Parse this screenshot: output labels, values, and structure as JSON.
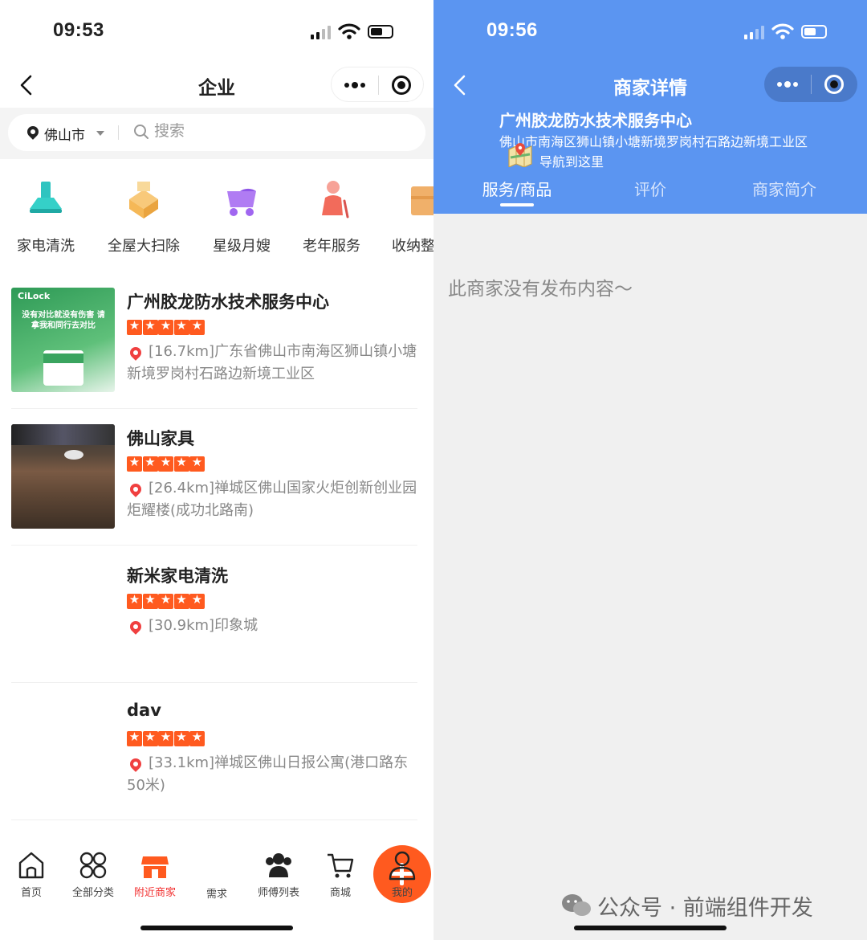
{
  "left": {
    "status": {
      "time": "09:53"
    },
    "nav": {
      "title": "企业"
    },
    "search": {
      "city": "佛山市",
      "placeholder": "搜索"
    },
    "categories": [
      {
        "label": "家电清洗",
        "icon": "range-hood-icon",
        "color": "#2ec4c0"
      },
      {
        "label": "全屋大扫除",
        "icon": "boxes-icon",
        "color": "#f5b857"
      },
      {
        "label": "星级月嫂",
        "icon": "baby-stroller-icon",
        "color": "#a066f0"
      },
      {
        "label": "老年服务",
        "icon": "elderly-icon",
        "color": "#f26b5b"
      },
      {
        "label": "收纳整",
        "icon": "storage-box-icon",
        "color": "#f0b06a"
      }
    ],
    "merchants": [
      {
        "name": "广州胶龙防水技术服务中心",
        "rating": 5,
        "address": "[16.7km]广东省佛山市南海区狮山镇小塘新境罗岗村石路边新境工业区",
        "thumb_text": "没有对比就没有伤害 请拿我和同行去对比",
        "thumb_brand": "CiLock"
      },
      {
        "name": "佛山家具",
        "rating": 5,
        "address": "[26.4km]禅城区佛山国家火炬创新创业园炬耀楼(成功北路南)"
      },
      {
        "name": "新米家电清洗",
        "rating": 5,
        "address": "[30.9km]印象城"
      },
      {
        "name": "dav",
        "rating": 5,
        "address": "[33.1km]禅城区佛山日报公寓(港口路东50米)"
      }
    ],
    "tabs": [
      {
        "label": "首页",
        "icon": "home-icon"
      },
      {
        "label": "全部分类",
        "icon": "grid-icon"
      },
      {
        "label": "附近商家",
        "icon": "shop-icon",
        "active": true
      },
      {
        "label": "需求",
        "icon": "plus-icon"
      },
      {
        "label": "师傅列表",
        "icon": "people-icon"
      },
      {
        "label": "商城",
        "icon": "cart-icon"
      },
      {
        "label": "我的",
        "icon": "user-icon"
      }
    ],
    "accent": "#ff5a1f"
  },
  "right": {
    "status": {
      "time": "09:56"
    },
    "nav": {
      "title": "商家详情"
    },
    "business": {
      "name": "广州胶龙防水技术服务中心",
      "address": "佛山市南海区狮山镇小塘新境罗岗村石路边新境工业区",
      "navigate": "导航到这里"
    },
    "tabs": [
      "服务/商品",
      "评价",
      "商家简介"
    ],
    "active_tab": 0,
    "empty_text": "此商家没有发布内容～",
    "watermark": "公众号 · 前端组件开发",
    "header_color": "#5b95f1"
  }
}
